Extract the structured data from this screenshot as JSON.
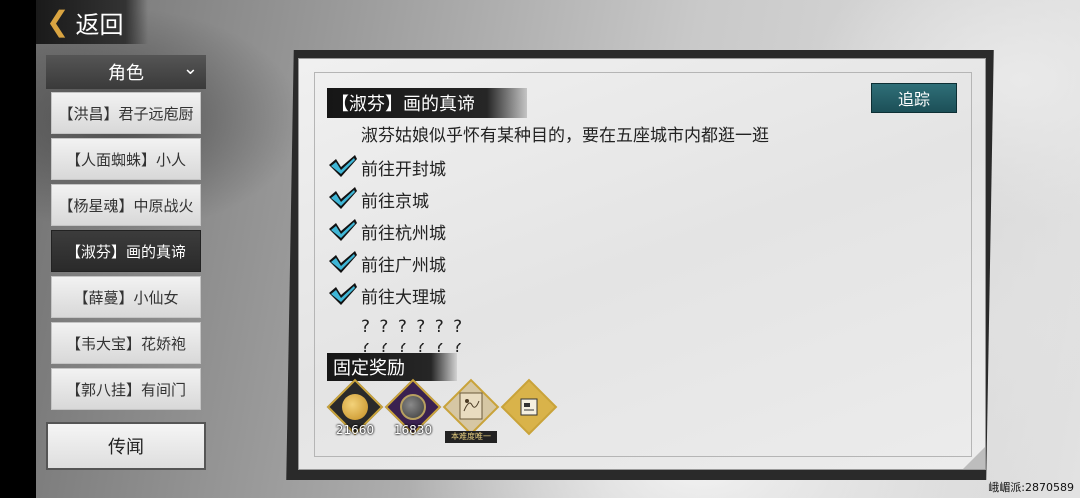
{
  "nav": {
    "back_label": "返回",
    "dropdown_label": "角色"
  },
  "quest_list": [
    {
      "label": "【洪昌】君子远庖厨",
      "active": false
    },
    {
      "label": "【人面蜘蛛】小人",
      "active": false
    },
    {
      "label": "【杨星魂】中原战火",
      "active": false
    },
    {
      "label": "【淑芬】画的真谛",
      "active": true
    },
    {
      "label": "【薛蔓】小仙女",
      "active": false
    },
    {
      "label": "【韦大宝】花娇袍",
      "active": false
    },
    {
      "label": "【郭八挂】有间门",
      "active": false
    }
  ],
  "rumor_label": "传闻",
  "quest": {
    "title": "【淑芬】画的真谛",
    "track_label": "追踪",
    "description": "淑芬姑娘似乎怀有某种目的，要在五座城市内都逛一逛",
    "objectives": [
      {
        "text": "前往开封城",
        "done": true
      },
      {
        "text": "前往京城",
        "done": true
      },
      {
        "text": "前往杭州城",
        "done": true
      },
      {
        "text": "前往广州城",
        "done": true
      },
      {
        "text": "前往大理城",
        "done": true
      }
    ],
    "unknown_1": "? ? ? ? ? ?",
    "unknown_2": "? ? ? ? ? ?"
  },
  "rewards": {
    "title": "固定奖励",
    "items": [
      {
        "icon": "gold-coin-icon",
        "amount": "21660",
        "color": "#d4a93a"
      },
      {
        "icon": "copper-coin-icon",
        "amount": "16830",
        "color": "#6b3f8a"
      },
      {
        "icon": "scroll-painting-icon",
        "tag": "本难度唯一",
        "color": "#c8b48a"
      },
      {
        "icon": "document-icon",
        "color": "#c9a33a"
      }
    ]
  },
  "watermark": "峨嵋派:2870589"
}
